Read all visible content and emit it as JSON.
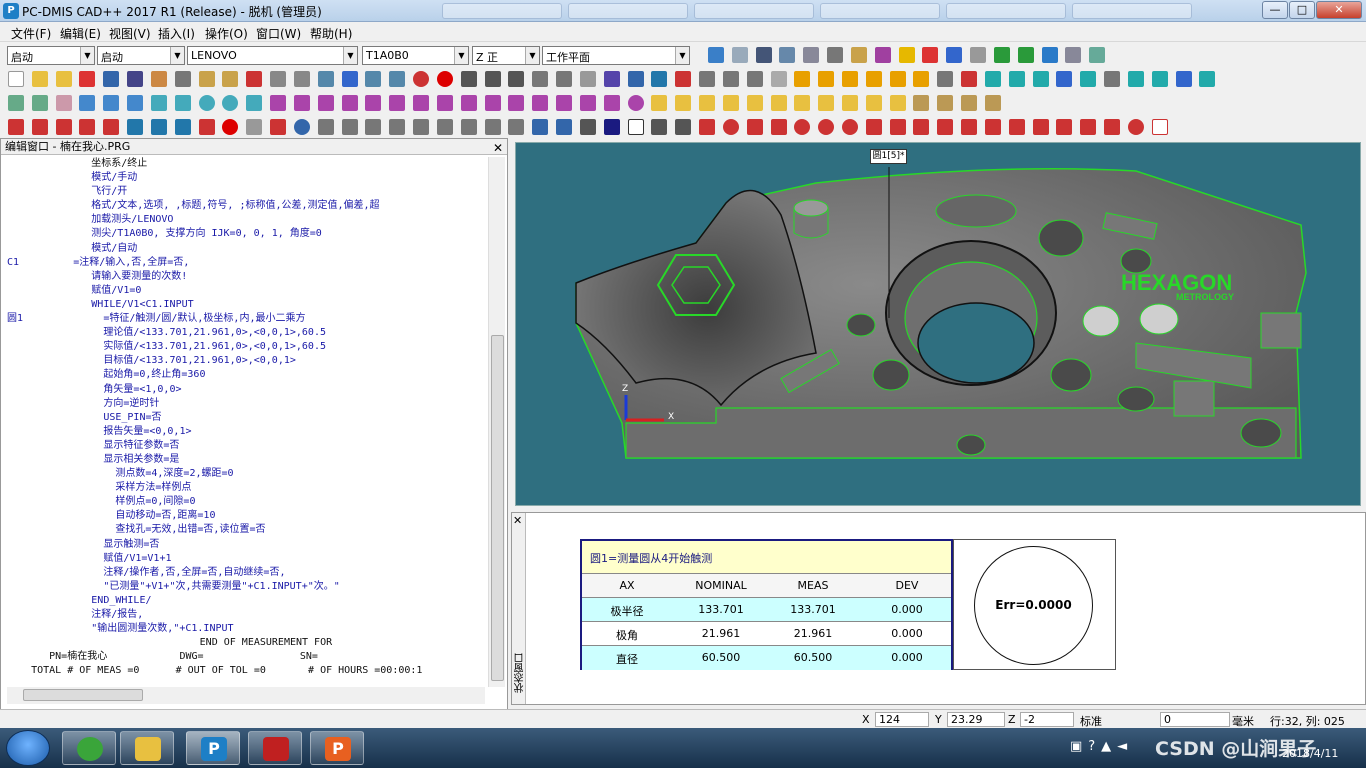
{
  "window": {
    "title": "PC-DMIS CAD++ 2017 R1 (Release) - 脱机 (管理员)",
    "min": "—",
    "max": "□",
    "close": "✕"
  },
  "menu": [
    "文件(F)",
    "编辑(E)",
    "视图(V)",
    "插入(I)",
    "操作(O)",
    "窗口(W)",
    "帮助(H)"
  ],
  "combos": {
    "mode1": "启动",
    "mode2": "启动",
    "probe": "LENOVO",
    "tip": "T1A0B0",
    "view": "Z 正",
    "plane": "工作平面"
  },
  "editor": {
    "title": "编辑窗口 - 楠在我心.PRG",
    "close": "✕",
    "lines": [
      {
        "l": "",
        "t": "              坐标系/终止",
        "c": "dark"
      },
      {
        "l": "",
        "t": "              模式/手动",
        "c": "blue"
      },
      {
        "l": "",
        "t": "              飞行/开",
        "c": "blue"
      },
      {
        "l": "",
        "t": "              格式/文本,选项, ,标题,符号, ;标称值,公差,测定值,偏差,超",
        "c": "blue"
      },
      {
        "l": "",
        "t": "              加载测头/LENOVO",
        "c": "blue"
      },
      {
        "l": "",
        "t": "              测尖/T1A0B0, 支撑方向 IJK=0, 0, 1, 角度=0",
        "c": "blue"
      },
      {
        "l": "",
        "t": "              模式/自动",
        "c": "blue"
      },
      {
        "l": "C1",
        "t": "           =注释/输入,否,全屏=否,",
        "c": "blue"
      },
      {
        "l": "",
        "t": "              请输入要测量的次数!",
        "c": "blue"
      },
      {
        "l": "",
        "t": "              赋值/V1=0",
        "c": "blue"
      },
      {
        "l": "",
        "t": "              WHILE/V1<C1.INPUT",
        "c": "blue"
      },
      {
        "l": "圆1",
        "t": "                =特征/触测/圆/默认,极坐标,内,最小二乘方",
        "c": "blue"
      },
      {
        "l": "",
        "t": "                理论值/<133.701,21.961,0>,<0,0,1>,60.5",
        "c": "blue"
      },
      {
        "l": "",
        "t": "                实际值/<133.701,21.961,0>,<0,0,1>,60.5",
        "c": "blue"
      },
      {
        "l": "",
        "t": "                目标值/<133.701,21.961,0>,<0,0,1>",
        "c": "blue"
      },
      {
        "l": "",
        "t": "                起始角=0,终止角=360",
        "c": "blue"
      },
      {
        "l": "",
        "t": "                角矢量=<1,0,0>",
        "c": "blue"
      },
      {
        "l": "",
        "t": "                方向=逆时针",
        "c": "blue"
      },
      {
        "l": "",
        "t": "                USE_PIN=否",
        "c": "blue"
      },
      {
        "l": "",
        "t": "                报告矢量=<0,0,1>",
        "c": "blue"
      },
      {
        "l": "",
        "t": "                显示特征参数=否",
        "c": "blue"
      },
      {
        "l": "",
        "t": "                显示相关参数=是",
        "c": "blue"
      },
      {
        "l": "",
        "t": "                  测点数=4,深度=2,螺距=0",
        "c": "blue"
      },
      {
        "l": "",
        "t": "                  采样方法=样例点",
        "c": "blue"
      },
      {
        "l": "",
        "t": "                  样例点=0,间隙=0",
        "c": "blue"
      },
      {
        "l": "",
        "t": "                  自动移动=否,距离=10",
        "c": "blue"
      },
      {
        "l": "",
        "t": "                  查找孔=无效,出错=否,读位置=否",
        "c": "blue"
      },
      {
        "l": "",
        "t": "                显示触测=否",
        "c": "blue"
      },
      {
        "l": "",
        "t": "                赋值/V1=V1+1",
        "c": "blue"
      },
      {
        "l": "",
        "t": "                注释/操作者,否,全屏=否,自动继续=否,",
        "c": "blue"
      },
      {
        "l": "",
        "t": "                \"已测量\"+V1+\"次,共需要测量\"+C1.INPUT+\"次。\"",
        "c": "blue"
      },
      {
        "l": "",
        "t": "              END_WHILE/",
        "c": "blue"
      },
      {
        "l": "",
        "t": "              注释/报告,",
        "c": "blue"
      },
      {
        "l": "",
        "t": "              \"输出圆测量次数,\"+C1.INPUT",
        "c": "blue"
      },
      {
        "l": "",
        "t": "                                END OF MEASUREMENT FOR",
        "c": "dark"
      },
      {
        "l": "",
        "t": "       PN=楠在我心            DWG=                SN=",
        "c": "dark"
      },
      {
        "l": "",
        "t": "    TOTAL # OF MEAS =0      # OUT OF TOL =0       # OF HOURS =00:00:1",
        "c": "dark"
      }
    ]
  },
  "viewport": {
    "label": "圆1[5]*",
    "logo": "HEXAGON",
    "logo_sub": "METROLOGY",
    "axis_z": "Z",
    "axis_x": "X"
  },
  "report": {
    "side_label": "状态窗口",
    "header": "圆1=测量圆从4开始触测",
    "columns": [
      "AX",
      "NOMINAL",
      "MEAS",
      "DEV"
    ],
    "rows": [
      [
        "极半径",
        "133.701",
        "133.701",
        "0.000"
      ],
      [
        "极角",
        "21.961",
        "21.961",
        "0.000"
      ],
      [
        "直径",
        "60.500",
        "60.500",
        "0.000"
      ]
    ],
    "err": "Err=0.0000",
    "colors": {
      "border": "#1a1a80",
      "header_bg": "#ffffcc",
      "row_bg": "#ccffff"
    }
  },
  "status": {
    "x_label": "X",
    "x_val": "124",
    "y_label": "Y",
    "y_val": "23.29",
    "z_label": "Z",
    "z_val": "-2",
    "mode": "标准",
    "count": "0",
    "unit": "毫米",
    "pos": "行:32, 列: 025"
  },
  "taskbar": {
    "time": "2018/4/11",
    "watermark": "CSDN @山涧果子"
  }
}
